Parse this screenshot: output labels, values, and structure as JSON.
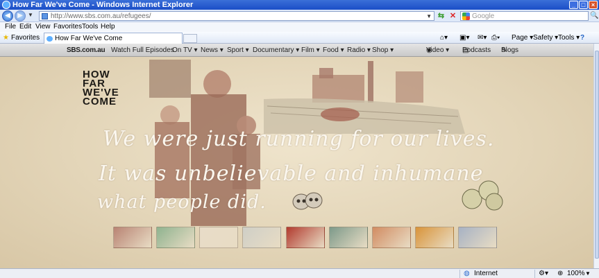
{
  "window": {
    "title": "How Far We've Come - Windows Internet Explorer"
  },
  "address_bar": {
    "url": "http://www.sbs.com.au/refugees/"
  },
  "search": {
    "placeholder": "Google"
  },
  "menu": [
    "File",
    "Edit",
    "View",
    "Favorites",
    "Tools",
    "Help"
  ],
  "favorites_bar": {
    "favorites_label": "Favorites",
    "tab_title": "How Far We've Come"
  },
  "command_bar": {
    "page": "Page ▾",
    "safety": "Safety ▾",
    "tools": "Tools ▾",
    "help": "?"
  },
  "sbs_nav": {
    "logo": "SBS.com.au",
    "items": [
      "Watch Full Episodes",
      "On TV ▾",
      "News ▾",
      "Sport ▾",
      "Documentary ▾",
      "Film ▾",
      "Food ▾",
      "Radio ▾",
      "Shop ▾"
    ],
    "video": "Video ▾",
    "podcasts": "Podcasts",
    "blogs": "Blogs"
  },
  "hero": {
    "logo_lines": [
      "HOW",
      "FAR",
      "WE'VE",
      "COME"
    ],
    "quote_lines": [
      "We were just running for our lives.",
      "It was unbelievable and inhumane",
      "what people did."
    ]
  },
  "thumbnails": [
    {
      "name": "story-thumb-1",
      "color": "#b98474"
    },
    {
      "name": "story-thumb-2",
      "color": "#8fb38f"
    },
    {
      "name": "story-thumb-3",
      "color": "#e8dcc8"
    },
    {
      "name": "story-thumb-4",
      "color": "#cfcfc7"
    },
    {
      "name": "story-thumb-5",
      "color": "#b23a2e"
    },
    {
      "name": "story-thumb-6",
      "color": "#7d9a8a"
    },
    {
      "name": "story-thumb-7",
      "color": "#d28c62"
    },
    {
      "name": "story-thumb-8",
      "color": "#d9943a"
    },
    {
      "name": "story-thumb-9",
      "color": "#a7b2c4"
    }
  ],
  "status_bar": {
    "zone": "Internet",
    "zoom": "100%"
  }
}
